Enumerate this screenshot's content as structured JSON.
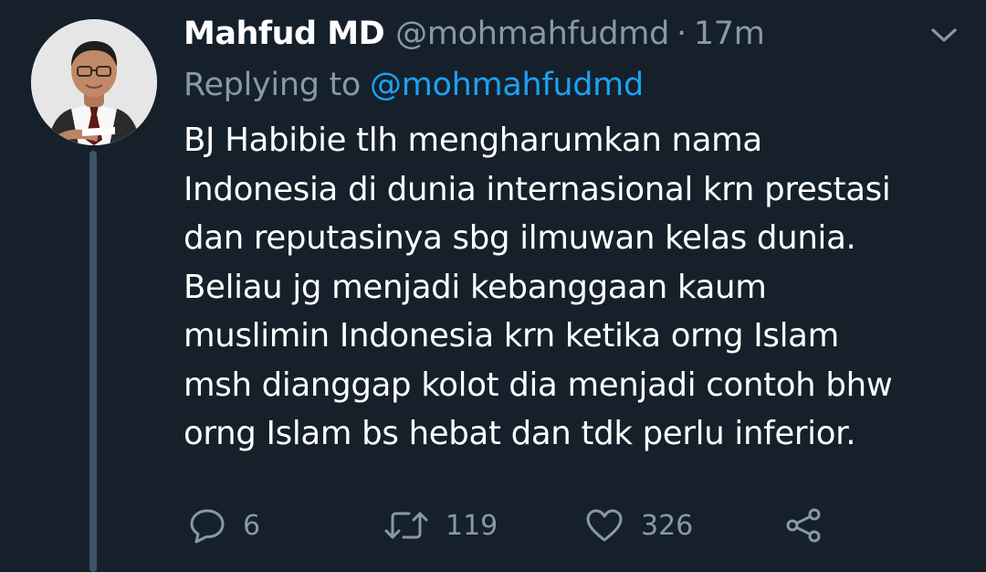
{
  "author": {
    "display_name": "Mahfud MD",
    "handle": "@mohmahfudmd",
    "separator": "·",
    "time": "17m"
  },
  "reply": {
    "label": "Replying to",
    "handle": "@mohmahfudmd"
  },
  "body": {
    "lines": [
      "BJ Habibie tlh mengharumkan nama",
      "Indonesia di dunia internasional krn prestasi",
      "dan reputasinya sbg ilmuwan kelas dunia.",
      "Beliau jg menjadi kebanggaan kaum",
      "muslimin Indonesia krn ketika orng Islam",
      "msh dianggap kolot dia menjadi contoh bhw",
      "orng Islam bs hebat dan tdk perlu inferior."
    ]
  },
  "actions": {
    "replies": "6",
    "retweets": "119",
    "likes": "326"
  },
  "icons": {
    "reply": "reply-bubble-icon",
    "retweet": "retweet-icon",
    "like": "heart-icon",
    "share": "share-icon",
    "menu": "chevron-down-icon"
  },
  "colors": {
    "background": "#15202b",
    "primary_text": "#ffffff",
    "secondary_text": "#8899a6",
    "link": "#1da1f2",
    "thread_line": "#3d5466"
  }
}
